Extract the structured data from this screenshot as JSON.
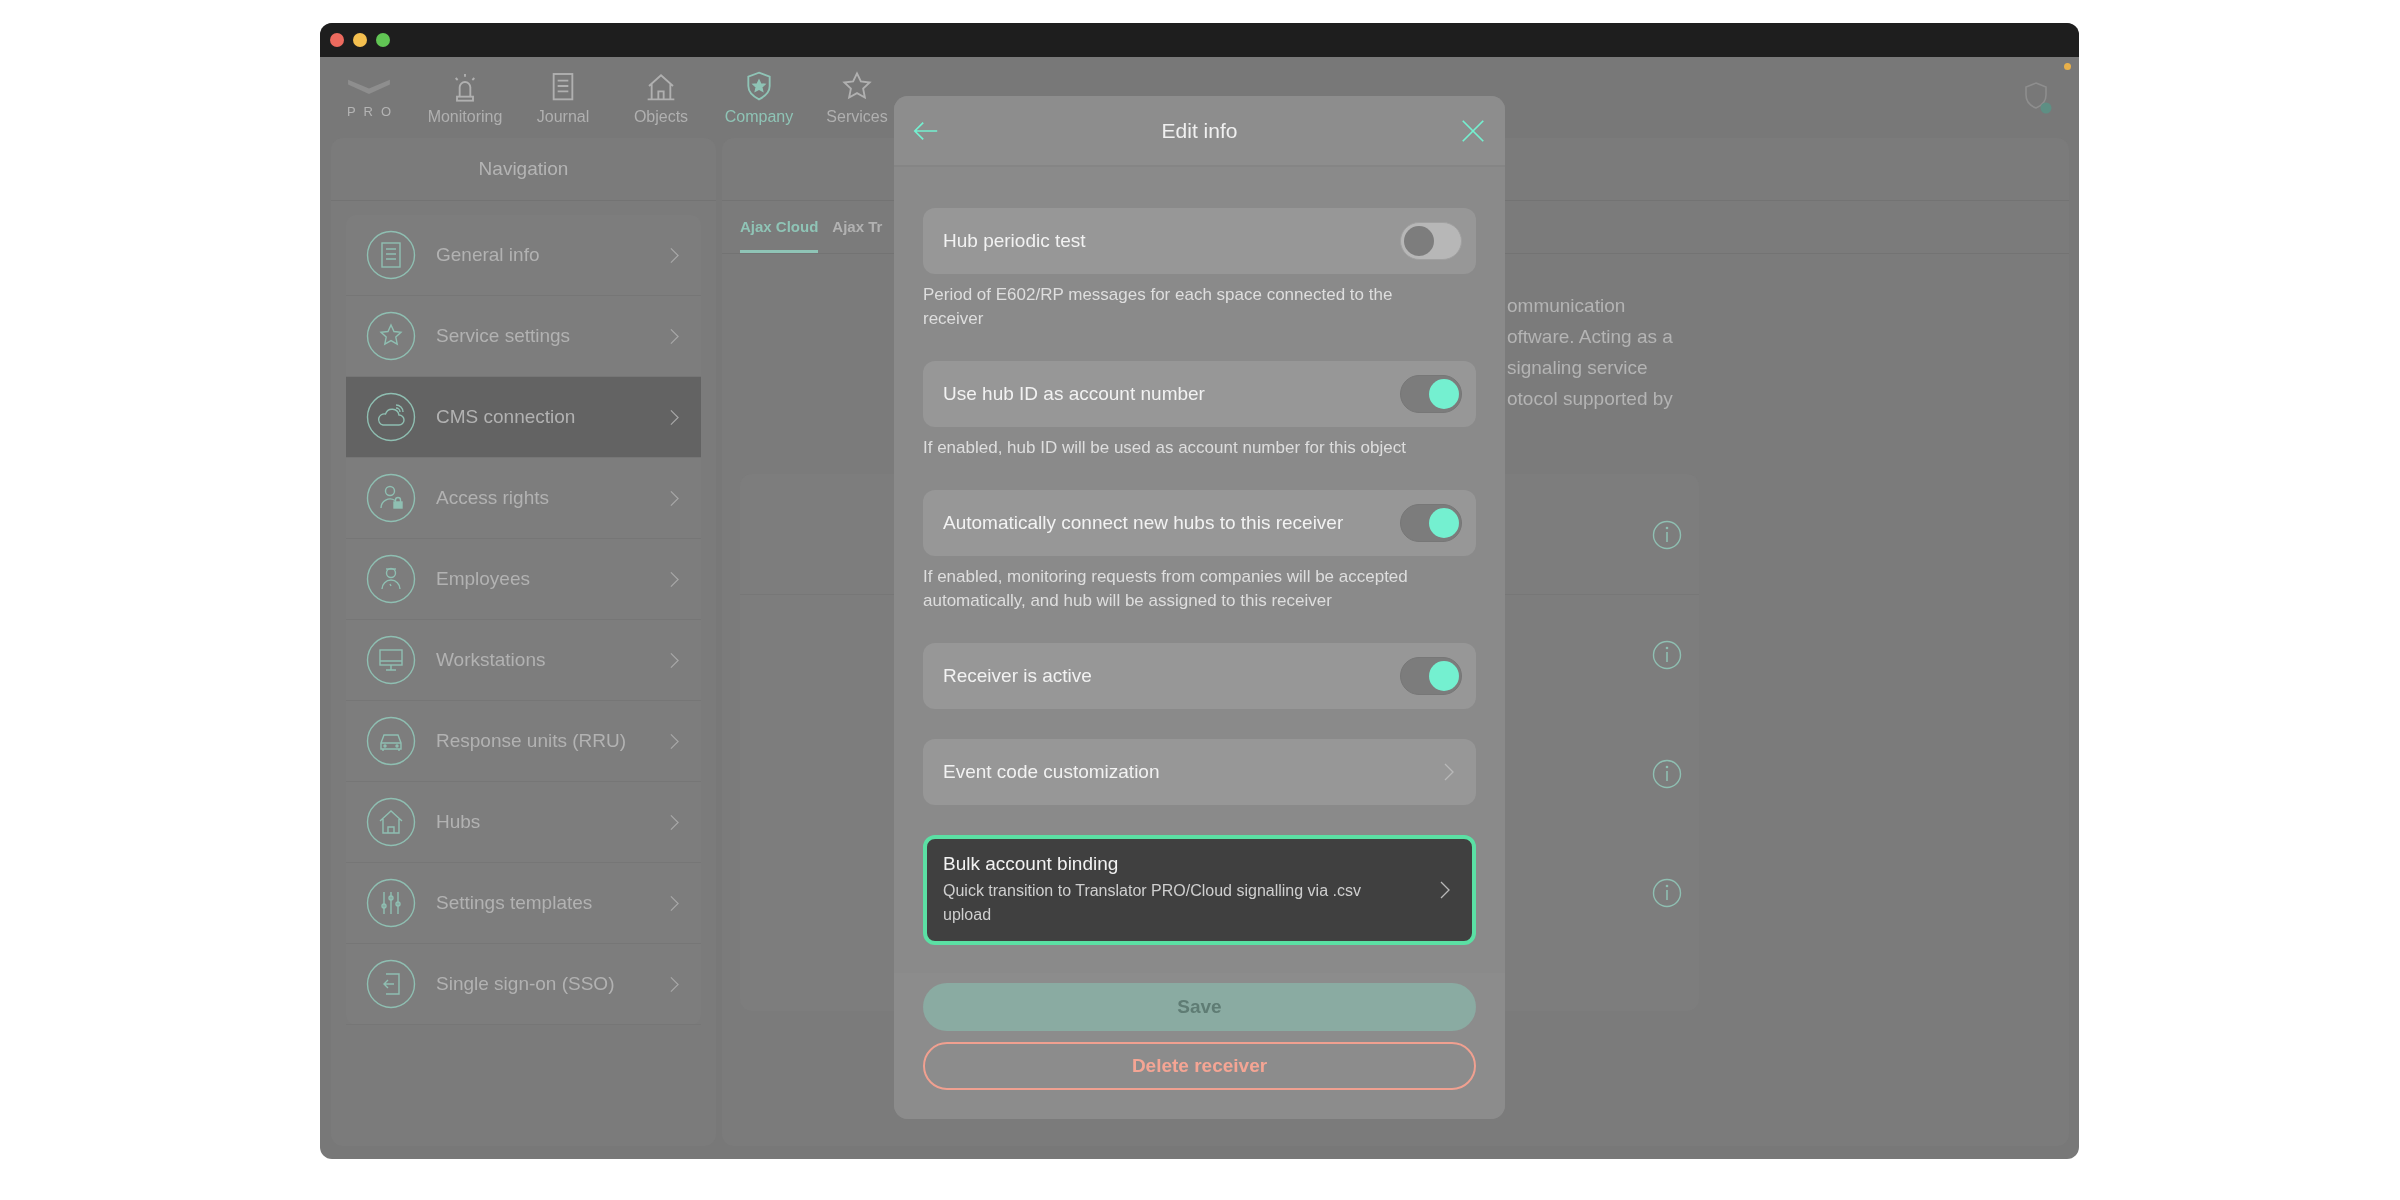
{
  "top_nav": {
    "logo_text": "PRO",
    "items": [
      {
        "label": "Monitoring",
        "selected": false
      },
      {
        "label": "Journal",
        "selected": false
      },
      {
        "label": "Objects",
        "selected": false
      },
      {
        "label": "Company",
        "selected": true
      },
      {
        "label": "Services",
        "selected": false
      }
    ]
  },
  "sidebar": {
    "title": "Navigation",
    "items": [
      {
        "label": "General info",
        "selected": false
      },
      {
        "label": "Service settings",
        "selected": false
      },
      {
        "label": "CMS connection",
        "selected": true
      },
      {
        "label": "Access rights",
        "selected": false
      },
      {
        "label": "Employees",
        "selected": false
      },
      {
        "label": "Workstations",
        "selected": false
      },
      {
        "label": "Response units (RRU)",
        "selected": false
      },
      {
        "label": "Hubs",
        "selected": false
      },
      {
        "label": "Settings templates",
        "selected": false
      },
      {
        "label": "Single sign-on (SSO)",
        "selected": false
      }
    ]
  },
  "main": {
    "tabs": [
      {
        "label": "Ajax Cloud",
        "selected": true
      },
      {
        "label": "Ajax Tr",
        "selected": false
      }
    ],
    "description_lines": [
      "ommunication",
      "oftware. Acting as a",
      "signaling service",
      "otocol supported by"
    ]
  },
  "dialog": {
    "title": "Edit info",
    "settings": [
      {
        "kind": "toggle",
        "label": "Hub periodic test",
        "on": false,
        "hint": "Period of E602/RP messages for each space connected to the receiver"
      },
      {
        "kind": "toggle",
        "label": "Use hub ID as account number",
        "on": true,
        "hint": "If enabled, hub ID will be used as account number for this object"
      },
      {
        "kind": "toggle",
        "label": "Automatically connect new hubs to this receiver",
        "on": true,
        "hint": "If enabled, monitoring requests from companies will be accepted automatically, and hub will be assigned to this receiver"
      },
      {
        "kind": "toggle",
        "label": "Receiver is active",
        "on": true
      },
      {
        "kind": "link",
        "label": "Event code customization",
        "focused": false
      },
      {
        "kind": "link",
        "label": "Bulk account binding",
        "subtitle": "Quick transition to Translator PRO/Cloud signalling via .csv upload",
        "focused": true
      }
    ],
    "save_button": {
      "label": "Save",
      "disabled": true
    },
    "delete_button": {
      "label": "Delete receiver"
    }
  }
}
